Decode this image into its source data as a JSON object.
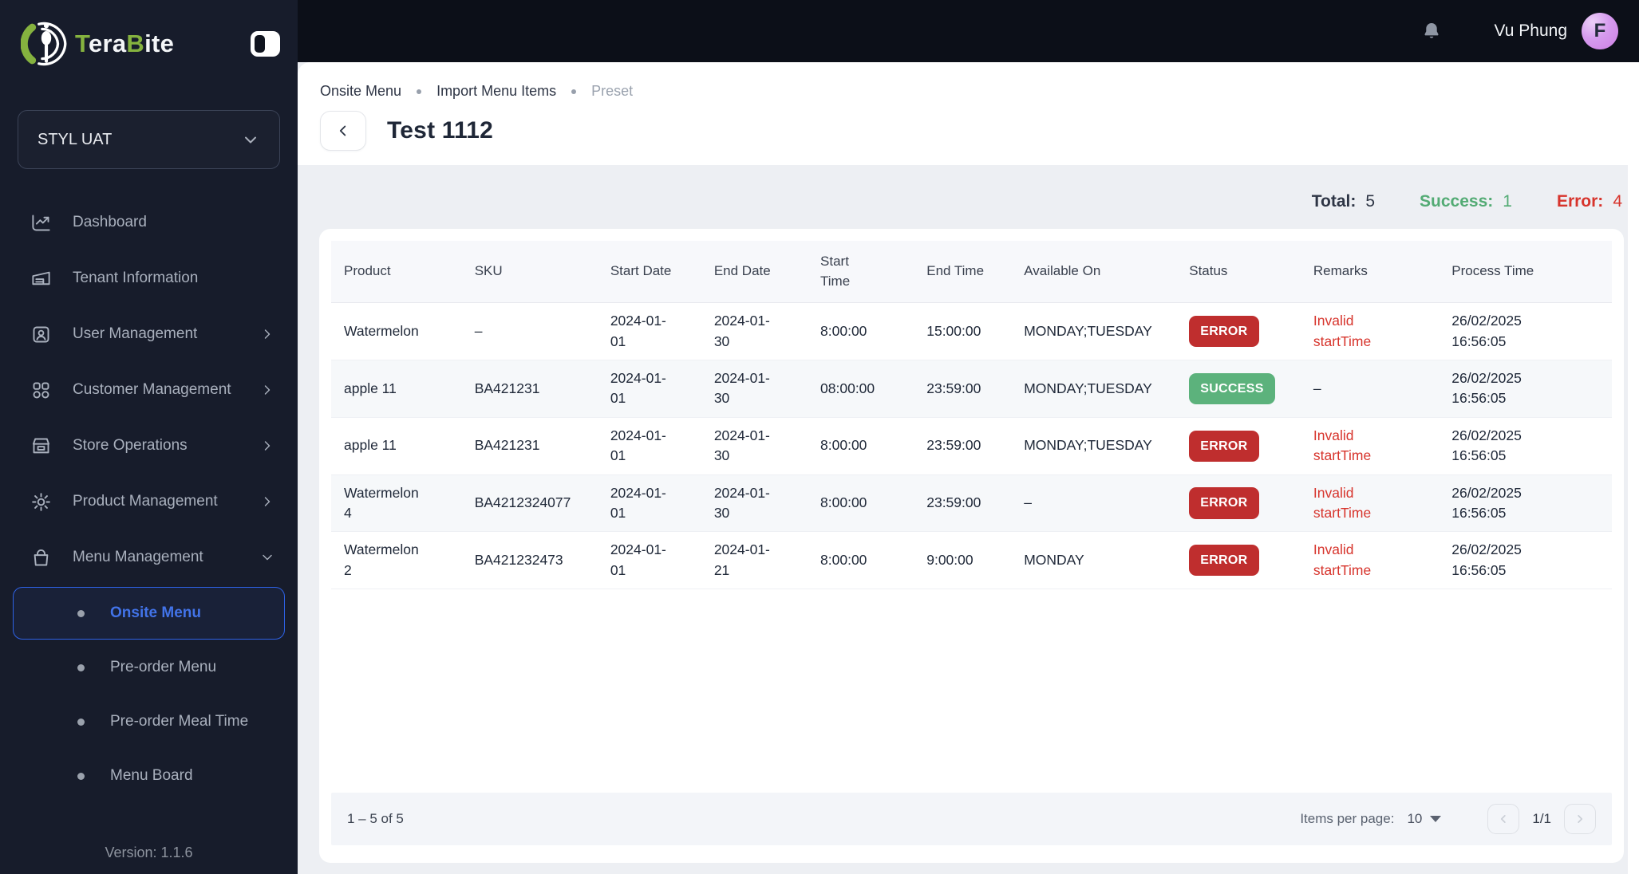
{
  "brand": {
    "parts": [
      "T",
      "era",
      "B",
      "ite"
    ]
  },
  "sidebar": {
    "tenant_select": {
      "value": "STYL UAT"
    },
    "items": [
      {
        "label": "Dashboard"
      },
      {
        "label": "Tenant Information"
      },
      {
        "label": "User Management"
      },
      {
        "label": "Customer Management"
      },
      {
        "label": "Store Operations"
      },
      {
        "label": "Product Management"
      },
      {
        "label": "Menu Management"
      }
    ],
    "submenu": [
      {
        "label": "Onsite Menu",
        "active": true
      },
      {
        "label": "Pre-order Menu",
        "active": false
      },
      {
        "label": "Pre-order Meal Time",
        "active": false
      },
      {
        "label": "Menu Board",
        "active": false
      }
    ],
    "version": "Version: 1.1.6"
  },
  "topbar": {
    "user_name": "Vu Phung",
    "avatar_initial": "F"
  },
  "page": {
    "breadcrumb": [
      "Onsite Menu",
      "Import Menu Items",
      "Preset"
    ],
    "title": "Test 1112",
    "stats": {
      "total_label": "Total:",
      "total_value": "5",
      "success_label": "Success:",
      "success_value": "1",
      "error_label": "Error:",
      "error_value": "4"
    }
  },
  "table": {
    "columns": [
      "Product",
      "SKU",
      "Start Date",
      "End Date",
      "Start Time",
      "End Time",
      "Available On",
      "Status",
      "Remarks",
      "Process Time"
    ],
    "rows": [
      {
        "product": "Watermelon",
        "sku": "–",
        "start_date": "2024-01-01",
        "end_date": "2024-01-30",
        "start_time": "8:00:00",
        "end_time": "15:00:00",
        "available_on": "MONDAY;TUESDAY",
        "status": "ERROR",
        "remarks": "Invalid startTime",
        "process_time": "26/02/2025 16:56:05"
      },
      {
        "product": "apple 11",
        "sku": "BA421231",
        "start_date": "2024-01-01",
        "end_date": "2024-01-30",
        "start_time": "08:00:00",
        "end_time": "23:59:00",
        "available_on": "MONDAY;TUESDAY",
        "status": "SUCCESS",
        "remarks": "–",
        "process_time": "26/02/2025 16:56:05"
      },
      {
        "product": "apple 11",
        "sku": "BA421231",
        "start_date": "2024-01-01",
        "end_date": "2024-01-30",
        "start_time": "8:00:00",
        "end_time": "23:59:00",
        "available_on": "MONDAY;TUESDAY",
        "status": "ERROR",
        "remarks": "Invalid startTime",
        "process_time": "26/02/2025 16:56:05"
      },
      {
        "product": "Watermelon 4",
        "sku": "BA4212324077",
        "start_date": "2024-01-01",
        "end_date": "2024-01-30",
        "start_time": "8:00:00",
        "end_time": "23:59:00",
        "available_on": "–",
        "status": "ERROR",
        "remarks": "Invalid startTime",
        "process_time": "26/02/2025 16:56:05"
      },
      {
        "product": "Watermelon 2",
        "sku": "BA421232473",
        "start_date": "2024-01-01",
        "end_date": "2024-01-21",
        "start_time": "8:00:00",
        "end_time": "9:00:00",
        "available_on": "MONDAY",
        "status": "ERROR",
        "remarks": "Invalid startTime",
        "process_time": "26/02/2025 16:56:05"
      }
    ],
    "footer": {
      "range": "1 – 5 of 5",
      "items_per_page_label": "Items per page:",
      "items_per_page": "10",
      "page_indicator": "1/1"
    }
  },
  "colors": {
    "error_badge": "#bf2e2e",
    "success_badge": "#5cb27c",
    "error_text": "#d7342c",
    "success_text": "#53ab74",
    "accent_blue": "#2e62e6"
  }
}
